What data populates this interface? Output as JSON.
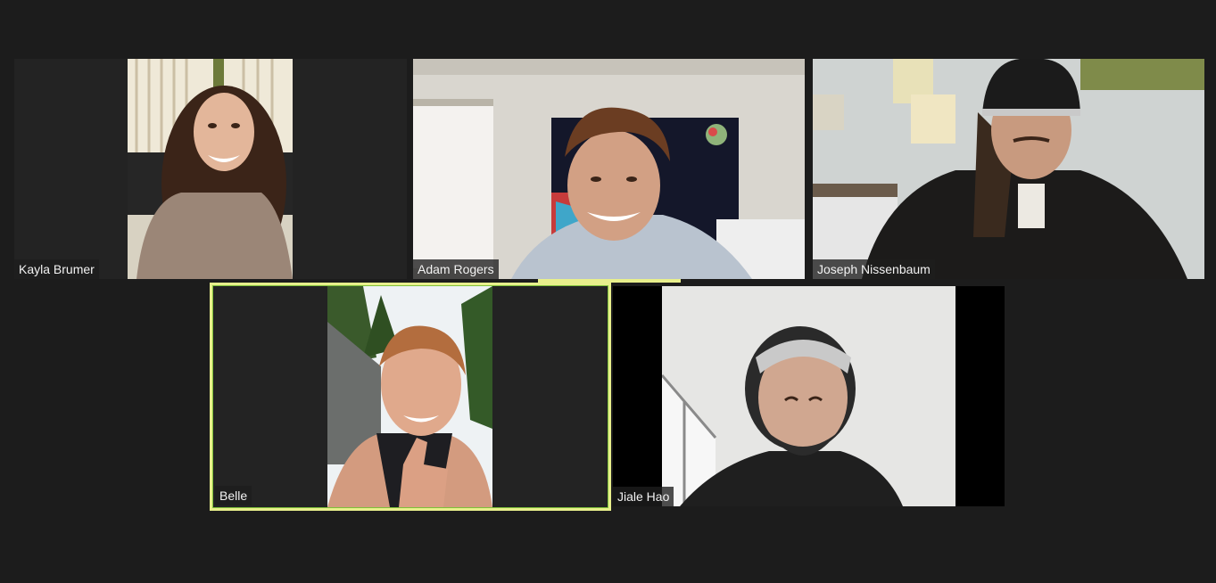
{
  "meeting": {
    "participants": [
      {
        "name": "Kayla Brumer"
      },
      {
        "name": "Adam Rogers"
      },
      {
        "name": "Joseph Nissenbaum"
      },
      {
        "name": "Belle"
      },
      {
        "name": "Jiale Hao"
      }
    ],
    "active_speaker": "Belle",
    "colors": {
      "background": "#1c1c1c",
      "tile_background": "#232323",
      "speaker_highlight": "#e8ef8c"
    }
  }
}
